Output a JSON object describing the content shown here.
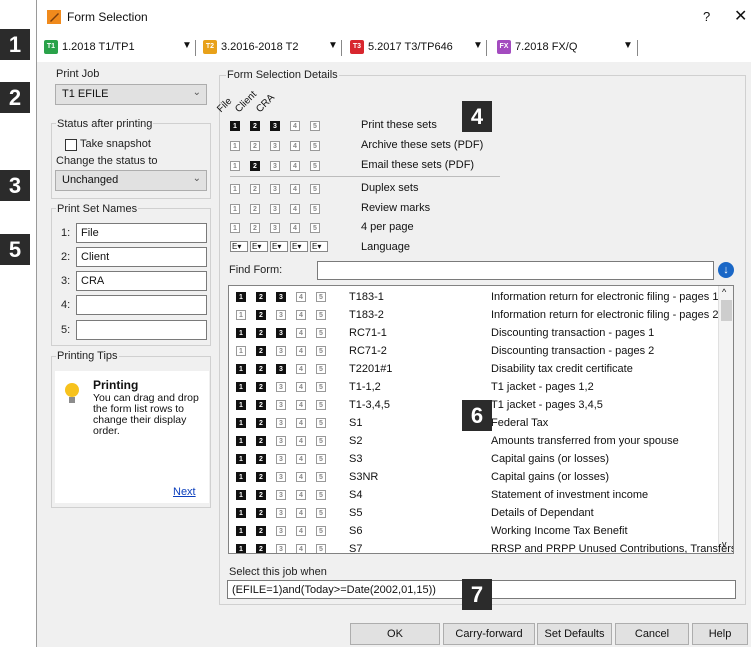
{
  "window": {
    "title": "Form Selection",
    "help": "?",
    "close": "✕"
  },
  "tabs": [
    {
      "badge": "T1",
      "label": "1.2018 T1/TP1",
      "color": "#2aa24a"
    },
    {
      "badge": "T2",
      "label": "3.2016-2018 T2",
      "color": "#e8a11a"
    },
    {
      "badge": "T3",
      "label": "5.2017 T3/TP646",
      "color": "#d8262e"
    },
    {
      "badge": "FX",
      "label": "7.2018 FX/Q",
      "color": "#a34bbf"
    }
  ],
  "print_job": {
    "label": "Print Job",
    "value": "T1 EFILE"
  },
  "status_after": {
    "label": "Status after printing",
    "snapshot": "Take snapshot",
    "change_label": "Change the status to",
    "value": "Unchanged"
  },
  "set_names": {
    "label": "Print Set Names",
    "items": [
      {
        "num": "1:",
        "value": "File"
      },
      {
        "num": "2:",
        "value": "Client"
      },
      {
        "num": "3:",
        "value": "CRA"
      },
      {
        "num": "4:",
        "value": ""
      },
      {
        "num": "5:",
        "value": ""
      }
    ]
  },
  "tips": {
    "label": "Printing Tips",
    "title": "Printing",
    "text": "You can drag and drop the form list rows to change their display order.",
    "next": "Next"
  },
  "details": {
    "label": "Form Selection Details",
    "col_headers": [
      "File",
      "Client",
      "CRA"
    ],
    "options": [
      {
        "label": "Print these sets",
        "sets": [
          1,
          1,
          1,
          0,
          0
        ]
      },
      {
        "label": "Archive these sets (PDF)",
        "sets": [
          0,
          0,
          0,
          0,
          0
        ]
      },
      {
        "label": "Email these sets (PDF)",
        "sets": [
          0,
          1,
          0,
          0,
          0
        ]
      },
      {
        "label": "Duplex sets",
        "sets": [
          0,
          0,
          0,
          0,
          0
        ]
      },
      {
        "label": "Review marks",
        "sets": [
          0,
          0,
          0,
          0,
          0
        ]
      },
      {
        "label": "4 per page",
        "sets": [
          0,
          0,
          0,
          0,
          0
        ]
      }
    ],
    "language_label": "Language",
    "lang_value": "E",
    "find_label": "Find Form:",
    "find_value": ""
  },
  "forms": [
    {
      "code": "T183-1",
      "desc": "Information return for electronic filing - pages 1",
      "sets": [
        1,
        1,
        1,
        0,
        0
      ]
    },
    {
      "code": "T183-2",
      "desc": "Information return for electronic filing - pages 2",
      "sets": [
        0,
        1,
        0,
        0,
        0
      ]
    },
    {
      "code": "RC71-1",
      "desc": "Discounting transaction - pages 1",
      "sets": [
        1,
        1,
        1,
        0,
        0
      ]
    },
    {
      "code": "RC71-2",
      "desc": "Discounting transaction - pages 2",
      "sets": [
        0,
        1,
        0,
        0,
        0
      ]
    },
    {
      "code": "T2201#1",
      "desc": "Disability tax credit certificate",
      "sets": [
        1,
        1,
        1,
        0,
        0
      ]
    },
    {
      "code": "T1-1,2",
      "desc": "T1 jacket - pages 1,2",
      "sets": [
        1,
        1,
        0,
        0,
        0
      ]
    },
    {
      "code": "T1-3,4,5",
      "desc": "T1 jacket - pages 3,4,5",
      "sets": [
        1,
        1,
        0,
        0,
        0
      ]
    },
    {
      "code": "S1",
      "desc": "Federal Tax",
      "sets": [
        1,
        1,
        0,
        0,
        0
      ]
    },
    {
      "code": "S2",
      "desc": "Amounts transferred from your spouse",
      "sets": [
        1,
        1,
        0,
        0,
        0
      ]
    },
    {
      "code": "S3",
      "desc": "Capital gains (or losses)",
      "sets": [
        1,
        1,
        0,
        0,
        0
      ]
    },
    {
      "code": "S3NR",
      "desc": "Capital gains (or losses)",
      "sets": [
        1,
        1,
        0,
        0,
        0
      ]
    },
    {
      "code": "S4",
      "desc": "Statement of investment income",
      "sets": [
        1,
        1,
        0,
        0,
        0
      ]
    },
    {
      "code": "S5",
      "desc": "Details of Dependant",
      "sets": [
        1,
        1,
        0,
        0,
        0
      ]
    },
    {
      "code": "S6",
      "desc": "Working Income Tax Benefit",
      "sets": [
        1,
        1,
        0,
        0,
        0
      ]
    },
    {
      "code": "S7",
      "desc": "RRSP and PRPP Unused Contributions, Transfers,...",
      "sets": [
        1,
        1,
        0,
        0,
        0
      ]
    }
  ],
  "select_when": {
    "label": "Select this job when",
    "value": "(EFILE=1)and(Today>=Date(2002,01,15))"
  },
  "buttons": {
    "ok": "OK",
    "carry": "Carry-forward",
    "defaults": "Set Defaults",
    "cancel": "Cancel",
    "help": "Help"
  },
  "callouts": [
    "1",
    "2",
    "3",
    "4",
    "5",
    "6",
    "7"
  ]
}
